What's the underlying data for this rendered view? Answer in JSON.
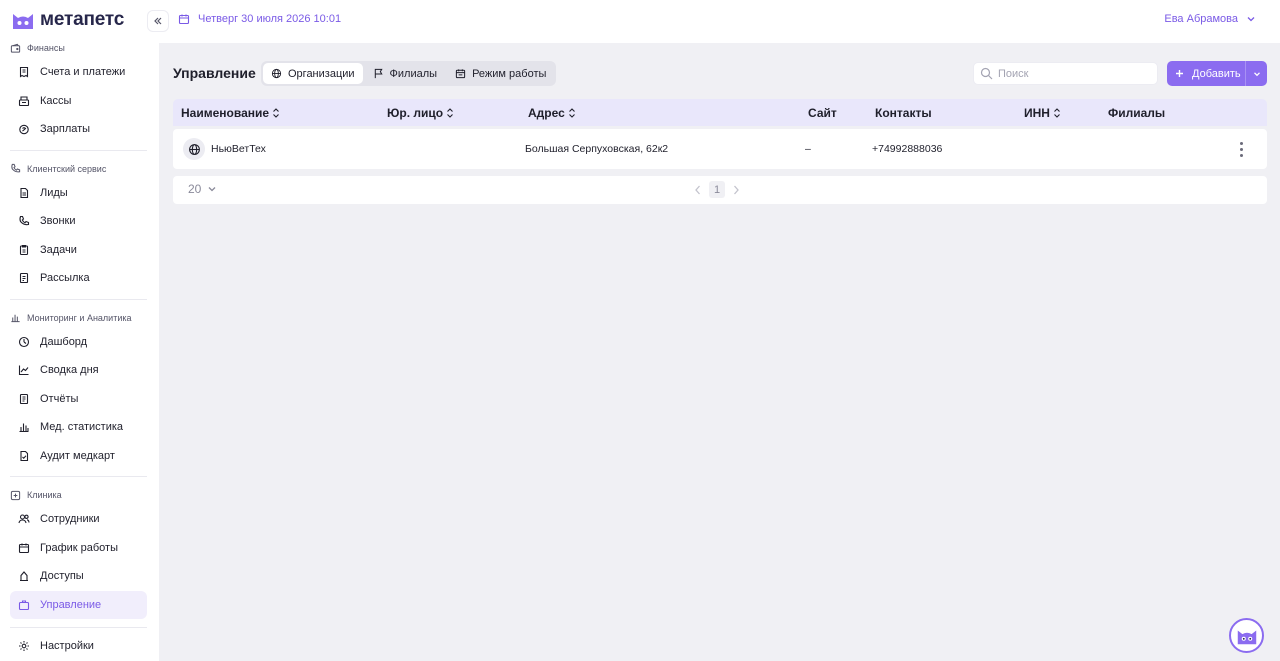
{
  "app": {
    "logo_text": "метапетс"
  },
  "header": {
    "date": "Четверг 30 июля 2026 10:01",
    "user_name": "Ева Абрамова"
  },
  "sidebar": {
    "sections": [
      {
        "title": "Финансы",
        "icon": "wallet-icon",
        "items": [
          {
            "label": "Счета и платежи",
            "icon": "receipt-icon"
          },
          {
            "label": "Кассы",
            "icon": "cash-register-icon"
          },
          {
            "label": "Зарплаты",
            "icon": "money-bag-icon"
          }
        ]
      },
      {
        "title": "Клиентский сервис",
        "icon": "phone-icon",
        "items": [
          {
            "label": "Лиды",
            "icon": "document-icon"
          },
          {
            "label": "Звонки",
            "icon": "phone-icon"
          },
          {
            "label": "Задачи",
            "icon": "clipboard-icon"
          },
          {
            "label": "Рассылка",
            "icon": "mail-icon"
          }
        ]
      },
      {
        "title": "Мониторинг и Аналитика",
        "icon": "analytics-icon",
        "items": [
          {
            "label": "Дашборд",
            "icon": "gauge-icon"
          },
          {
            "label": "Сводка дня",
            "icon": "line-chart-icon"
          },
          {
            "label": "Отчёты",
            "icon": "report-icon"
          },
          {
            "label": "Мед. статистика",
            "icon": "bar-chart-icon"
          },
          {
            "label": "Аудит медкарт",
            "icon": "audit-icon"
          }
        ]
      },
      {
        "title": "Клиника",
        "icon": "clinic-icon",
        "items": [
          {
            "label": "Сотрудники",
            "icon": "users-icon"
          },
          {
            "label": "График работы",
            "icon": "calendar-icon"
          },
          {
            "label": "Доступы",
            "icon": "lock-icon"
          },
          {
            "label": "Управление",
            "icon": "briefcase-icon",
            "active": true
          }
        ]
      }
    ],
    "settings": {
      "label": "Настройки",
      "icon": "gear-icon"
    }
  },
  "toolbar": {
    "title": "Управление",
    "tabs": [
      {
        "label": "Организации",
        "icon": "globe-icon",
        "active": true
      },
      {
        "label": "Филиалы",
        "icon": "flag-icon"
      },
      {
        "label": "Режим работы",
        "icon": "calendar-icon"
      }
    ],
    "search_placeholder": "Поиск",
    "add_label": "Добавить"
  },
  "table": {
    "columns": [
      {
        "label": "Наименование",
        "sortable": true
      },
      {
        "label": "Юр. лицо",
        "sortable": true
      },
      {
        "label": "Адрес",
        "sortable": true
      },
      {
        "label": "Сайт",
        "sortable": false
      },
      {
        "label": "Контакты",
        "sortable": false
      },
      {
        "label": "ИНН",
        "sortable": true
      },
      {
        "label": "Филиалы",
        "sortable": false
      }
    ],
    "rows": [
      {
        "name": "НьюВетТех",
        "legal": "",
        "address": "Большая Серпуховская, 62к2",
        "site": "–",
        "contacts": "+74992888036",
        "inn": "",
        "branches": ""
      }
    ]
  },
  "pagination": {
    "page_size": "20",
    "current_page": "1"
  },
  "colors": {
    "accent": "#8b6cf0",
    "accent_text": "#7a5ae6",
    "header_row": "#e9e7fb",
    "background": "#f0f0f4"
  }
}
